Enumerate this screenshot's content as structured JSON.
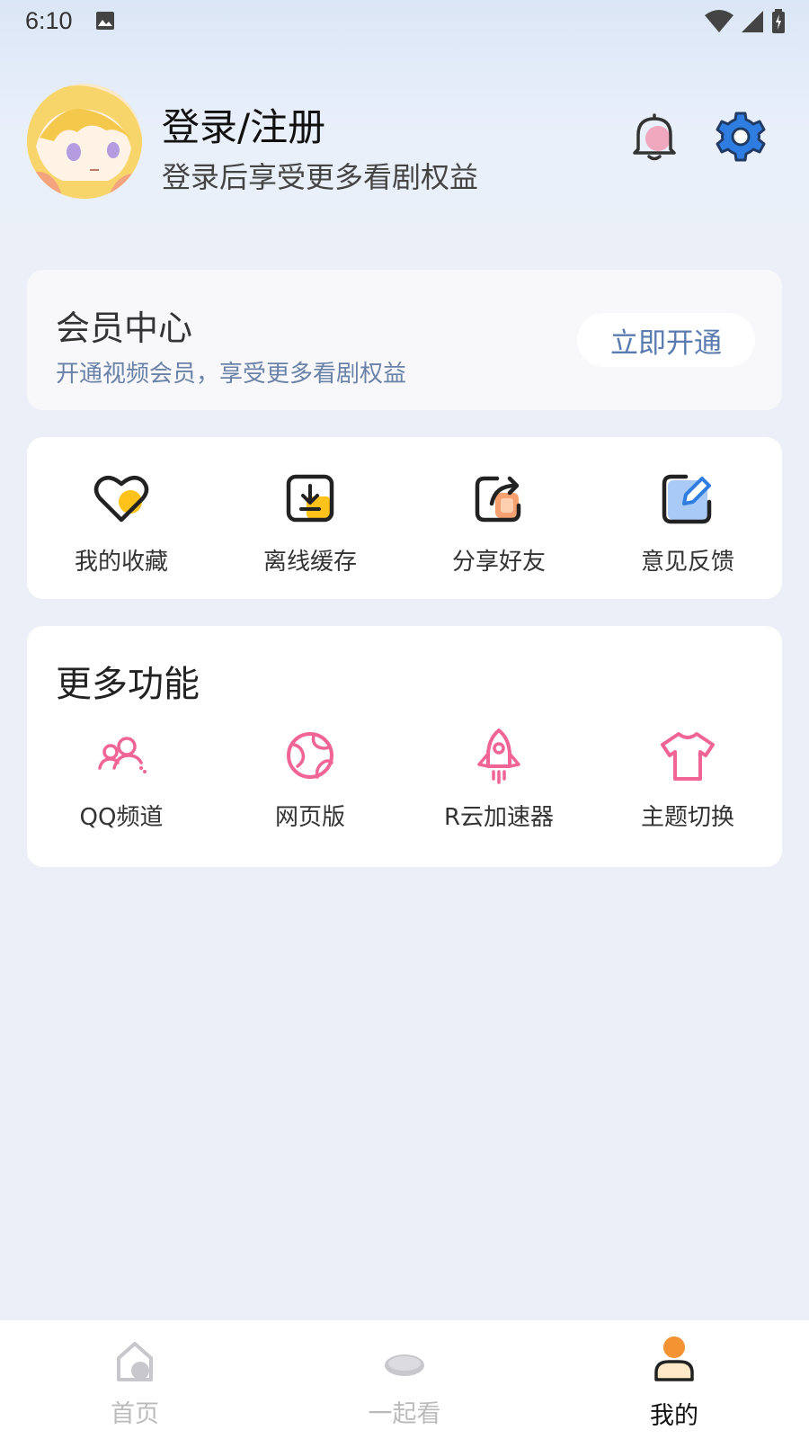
{
  "status_bar": {
    "time": "6:10"
  },
  "profile": {
    "title": "登录/注册",
    "subtitle": "登录后享受更多看剧权益"
  },
  "vip": {
    "title": "会员中心",
    "subtitle": "开通视频会员，享受更多看剧权益",
    "button": "立即开通"
  },
  "quick_actions": [
    {
      "label": "我的收藏",
      "icon": "heart-icon"
    },
    {
      "label": "离线缓存",
      "icon": "download-icon"
    },
    {
      "label": "分享好友",
      "icon": "share-icon"
    },
    {
      "label": "意见反馈",
      "icon": "edit-icon"
    }
  ],
  "more": {
    "title": "更多功能",
    "items": [
      {
        "label": "QQ频道",
        "icon": "group-icon"
      },
      {
        "label": "网页版",
        "icon": "globe-icon"
      },
      {
        "label": "R云加速器",
        "icon": "rocket-icon"
      },
      {
        "label": "主题切换",
        "icon": "shirt-icon"
      }
    ]
  },
  "bottom_nav": [
    {
      "label": "首页",
      "icon": "home-icon"
    },
    {
      "label": "一起看",
      "icon": "watch-together-icon"
    },
    {
      "label": "我的",
      "icon": "profile-icon"
    }
  ],
  "colors": {
    "accent_pink": "#f06595",
    "accent_blue": "#2f7de1",
    "accent_yellow": "#ffc21a",
    "link_blue": "#5a7bb0"
  }
}
